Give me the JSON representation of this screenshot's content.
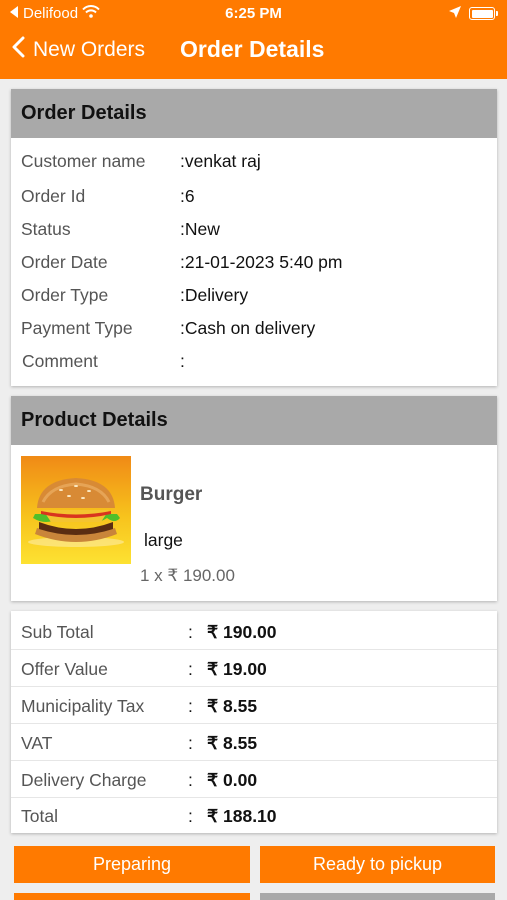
{
  "status_bar": {
    "carrier": "Delifood",
    "time": "6:25 PM"
  },
  "nav": {
    "back_label": "New Orders",
    "title": "Order Details"
  },
  "order_details": {
    "heading": "Order Details",
    "rows": [
      {
        "label": "Customer name",
        "value": ":venkat  raj"
      },
      {
        "label": "Order Id",
        "value": ":6"
      },
      {
        "label": "Status",
        "value": ":New"
      },
      {
        "label": "Order Date",
        "value": ":21-01-2023 5:40 pm"
      },
      {
        "label": "Order Type",
        "value": ":Delivery"
      },
      {
        "label": "Payment Type",
        "value": ":Cash on delivery"
      },
      {
        "label": "Comment",
        "value": ":"
      }
    ]
  },
  "product_details": {
    "heading": "Product Details",
    "items": [
      {
        "name": "Burger",
        "size": "large",
        "quantity_price": "1 x ₹ 190.00"
      }
    ]
  },
  "totals": {
    "colon": ":",
    "rows": [
      {
        "label": "Sub Total",
        "value": "₹ 190.00"
      },
      {
        "label": "Offer Value",
        "value": "₹ 19.00"
      },
      {
        "label": "Municipality Tax",
        "value": "₹ 8.55"
      },
      {
        "label": "VAT",
        "value": "₹ 8.55"
      },
      {
        "label": "Delivery Charge",
        "value": "₹ 0.00"
      },
      {
        "label": "Total",
        "value": "₹ 188.10"
      }
    ]
  },
  "actions": {
    "preparing_label": "Preparing",
    "ready_label": "Ready to pickup"
  },
  "colors": {
    "accent": "#ff7a00",
    "section_header": "#a9a9a9",
    "background": "#eeeeee"
  }
}
